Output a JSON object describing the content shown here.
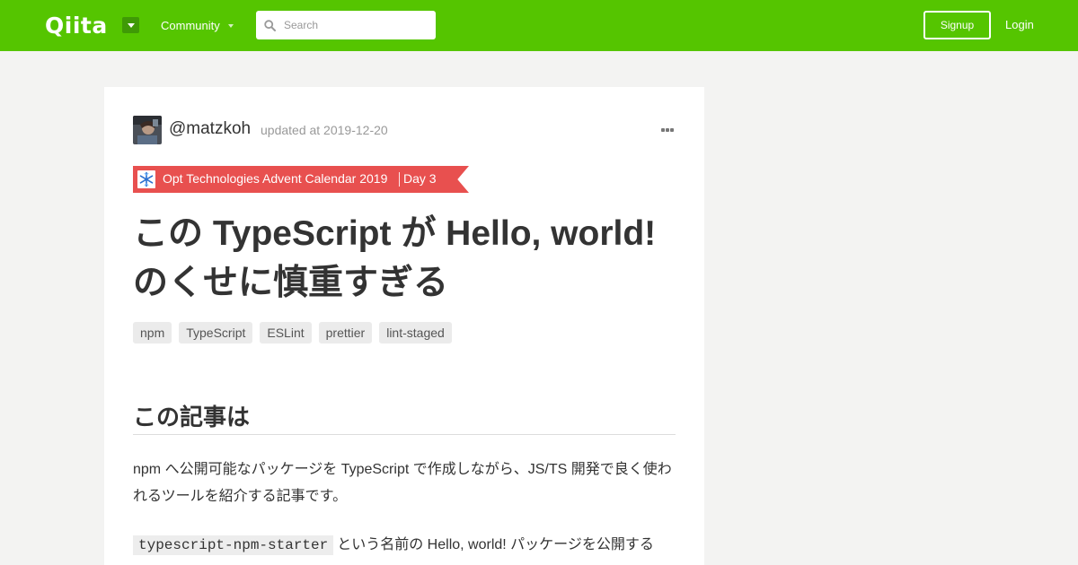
{
  "header": {
    "logo": "Qiita",
    "community_label": "Community",
    "search": {
      "placeholder": "Search",
      "value": ""
    },
    "signup_label": "Signup",
    "login_label": "Login",
    "brand_color": "#55c500"
  },
  "article": {
    "author": "@matzkoh",
    "updated": "updated at 2019-12-20",
    "calendar": {
      "title": "Opt Technologies Advent Calendar 2019",
      "day": "Day 3",
      "color": "#e8504f"
    },
    "title": "この TypeScript が Hello, world! のくせに慎重すぎる",
    "tags": [
      "npm",
      "TypeScript",
      "ESLint",
      "prettier",
      "lint-staged"
    ],
    "section_heading": "この記事は",
    "paragraph1": "npm へ公開可能なパッケージを TypeScript で作成しながら、JS/TS 開発で良く使われるツールを紹介する記事です。",
    "paragraph2_code": "typescript-npm-starter",
    "paragraph2_text": "という名前の Hello, world! パッケージを公開する"
  }
}
